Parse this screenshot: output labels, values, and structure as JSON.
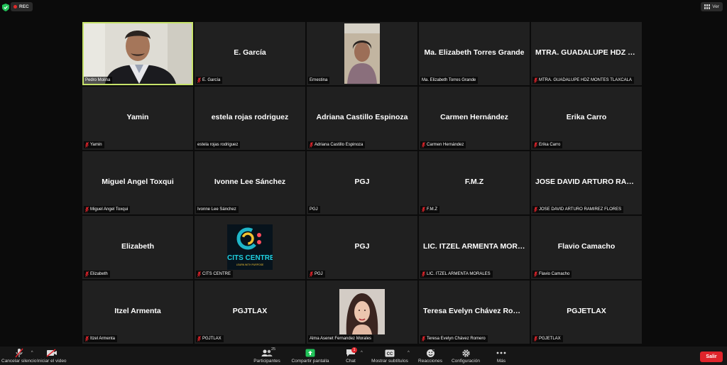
{
  "topbar": {
    "rec_label": "REC",
    "view_label": "Ver"
  },
  "tiles": [
    {
      "name": "",
      "label": "Pedro Molina",
      "muted": false,
      "video": "camera"
    },
    {
      "name": "E. García",
      "label": "E. García",
      "muted": true
    },
    {
      "name": "",
      "label": "Ernestina",
      "muted": false,
      "video": "portrait"
    },
    {
      "name": "Ma. Elizabeth Torres Grande",
      "label": "Ma. Elizabeth Torres Grande",
      "muted": false
    },
    {
      "name": "MTRA. GUADALUPE HDZ M...",
      "label": "MTRA. GUADALUPE HDZ MONTES TLAXCALA",
      "muted": true
    },
    {
      "name": "Yamin",
      "label": "Yamin",
      "muted": true
    },
    {
      "name": "estela rojas rodriguez",
      "label": "estela rojas rodriguez",
      "muted": false
    },
    {
      "name": "Adriana Castillo Espinoza",
      "label": "Adriana Castillo Espinoza",
      "muted": true
    },
    {
      "name": "Carmen Hernández",
      "label": "Carmen Hernández",
      "muted": true
    },
    {
      "name": "Erika Carro",
      "label": "Erika Carro",
      "muted": true
    },
    {
      "name": "Miguel Angel Toxqui",
      "label": "Miguel Angel Toxqui",
      "muted": true
    },
    {
      "name": "Ivonne Lee Sánchez",
      "label": "Ivonne Lee Sánchez",
      "muted": false
    },
    {
      "name": "PGJ",
      "label": "PGJ",
      "muted": false
    },
    {
      "name": "F.M.Z",
      "label": "F.M.Z",
      "muted": true
    },
    {
      "name": "JOSE DAVID ARTURO RAMI...",
      "label": "JOSE DAVID ARTURO RAMIREZ FLORES",
      "muted": true
    },
    {
      "name": "Elizabeth",
      "label": "Elizabeth",
      "muted": true
    },
    {
      "name": "",
      "label": "CITS CENTRE",
      "muted": true,
      "video": "logo"
    },
    {
      "name": "PGJ",
      "label": "PGJ",
      "muted": true
    },
    {
      "name": "LIC. ITZEL ARMENTA MORA...",
      "label": "LIC. ITZEL ARMENTA MORALES",
      "muted": true
    },
    {
      "name": "Flavio Camacho",
      "label": "Flavio Camacho",
      "muted": true
    },
    {
      "name": "Itzel Armenta",
      "label": "Itzel Armenta",
      "muted": true
    },
    {
      "name": "PGJTLAX",
      "label": "PGJTLAX",
      "muted": true
    },
    {
      "name": "",
      "label": "Alma Asenet Fernandez Morales",
      "muted": false,
      "video": "portrait2"
    },
    {
      "name": "Teresa Evelyn Chávez Rom...",
      "label": "Teresa Evelyn Chávez Romero",
      "muted": true
    },
    {
      "name": "PGJETLAX",
      "label": "PGJETLAX",
      "muted": true
    }
  ],
  "logo": {
    "title": "CITS CENTRE",
    "tagline": "LEARN WITH PURPOSE"
  },
  "toolbar": {
    "unmute_label": "Cancelar silencio",
    "video_label": "Iniciar el video",
    "participants_label": "Participantes",
    "participants_count": "25",
    "share_label": "Compartir pantalla",
    "chat_label": "Chat",
    "chat_badge": "1",
    "captions_label": "Mostrar subtítulos",
    "reactions_label": "Reacciones",
    "settings_label": "Configuración",
    "more_label": "Más",
    "leave_label": "Salir"
  },
  "colors": {
    "active_speaker": "#c6e26a",
    "leave": "#e0242b",
    "share": "#22c35a",
    "muted": "#e0242b"
  }
}
